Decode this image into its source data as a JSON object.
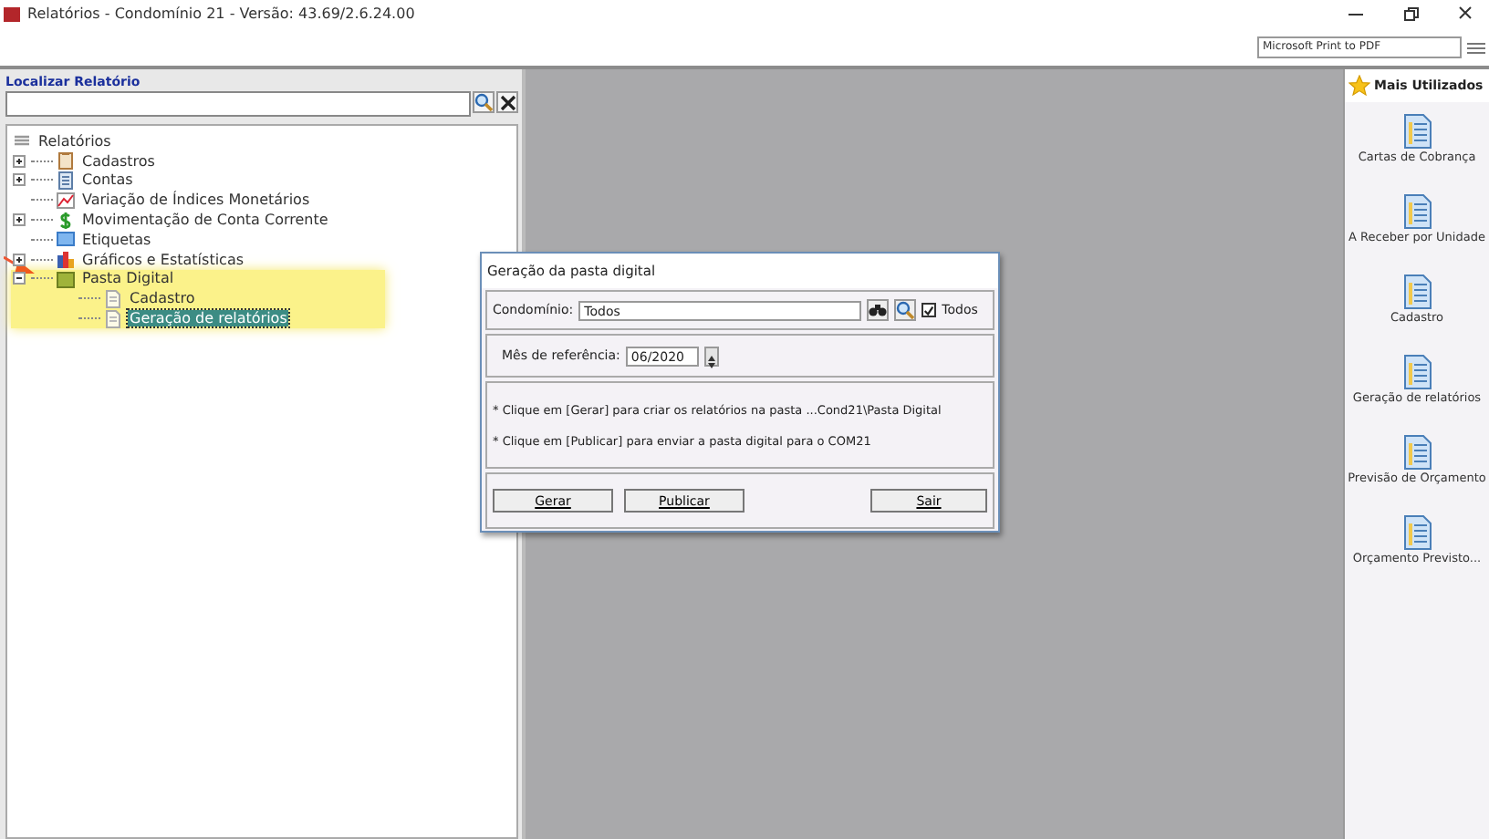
{
  "window": {
    "title": "Relatórios - Condomínio 21 - Versão: 43.69/2.6.24.00"
  },
  "printer": {
    "value": "Microsoft Print to PDF"
  },
  "search": {
    "label": "Localizar Relatório"
  },
  "tree": {
    "label": "Relatórios",
    "children": [
      {
        "label": "Cadastros",
        "kind": "form",
        "expandable": true,
        "expanded": false,
        "selected": false
      },
      {
        "label": "Contas",
        "kind": "list",
        "expandable": true,
        "expanded": false,
        "selected": false
      },
      {
        "label": "Variação de Índices Monetários",
        "kind": "chart",
        "expandable": false,
        "selected": false
      },
      {
        "label": "Movimentação de Conta Corrente",
        "kind": "money",
        "expandable": true,
        "expanded": false,
        "selected": false
      },
      {
        "label": "Etiquetas",
        "kind": "label",
        "expandable": false,
        "selected": false
      },
      {
        "label": "Gráficos e Estatísticas",
        "kind": "bars",
        "expandable": true,
        "expanded": false,
        "selected": false
      },
      {
        "label": "Pasta Digital",
        "kind": "folder",
        "expandable": true,
        "expanded": true,
        "selected": false,
        "highlighted": true,
        "children": [
          {
            "label": "Cadastro",
            "kind": "page",
            "expandable": false,
            "selected": false
          },
          {
            "label": "Geração de relatórios",
            "kind": "page",
            "expandable": false,
            "selected": true
          }
        ]
      }
    ]
  },
  "dialog": {
    "title": "Geração da pasta digital",
    "condominio": {
      "label": "Condomínio:",
      "value": "Todos",
      "todos_label": "Todos",
      "todos_checked": true
    },
    "mes": {
      "label": "Mês de referência:",
      "value": "06/2020"
    },
    "notes": [
      "* Clique em [Gerar] para criar os relatórios na pasta ...Cond21\\Pasta Digital",
      "* Clique em [Publicar] para enviar a pasta digital para o COM21"
    ],
    "buttons": [
      "Gerar",
      "Publicar",
      "Sair"
    ]
  },
  "favorites": {
    "title": "Mais Utilizados",
    "items": [
      "Cartas de Cobrança",
      "A Receber por Unidade",
      "Cadastro",
      "Geração de relatórios",
      "Previsão de Orçamento",
      "Orçamento Previsto..."
    ]
  }
}
